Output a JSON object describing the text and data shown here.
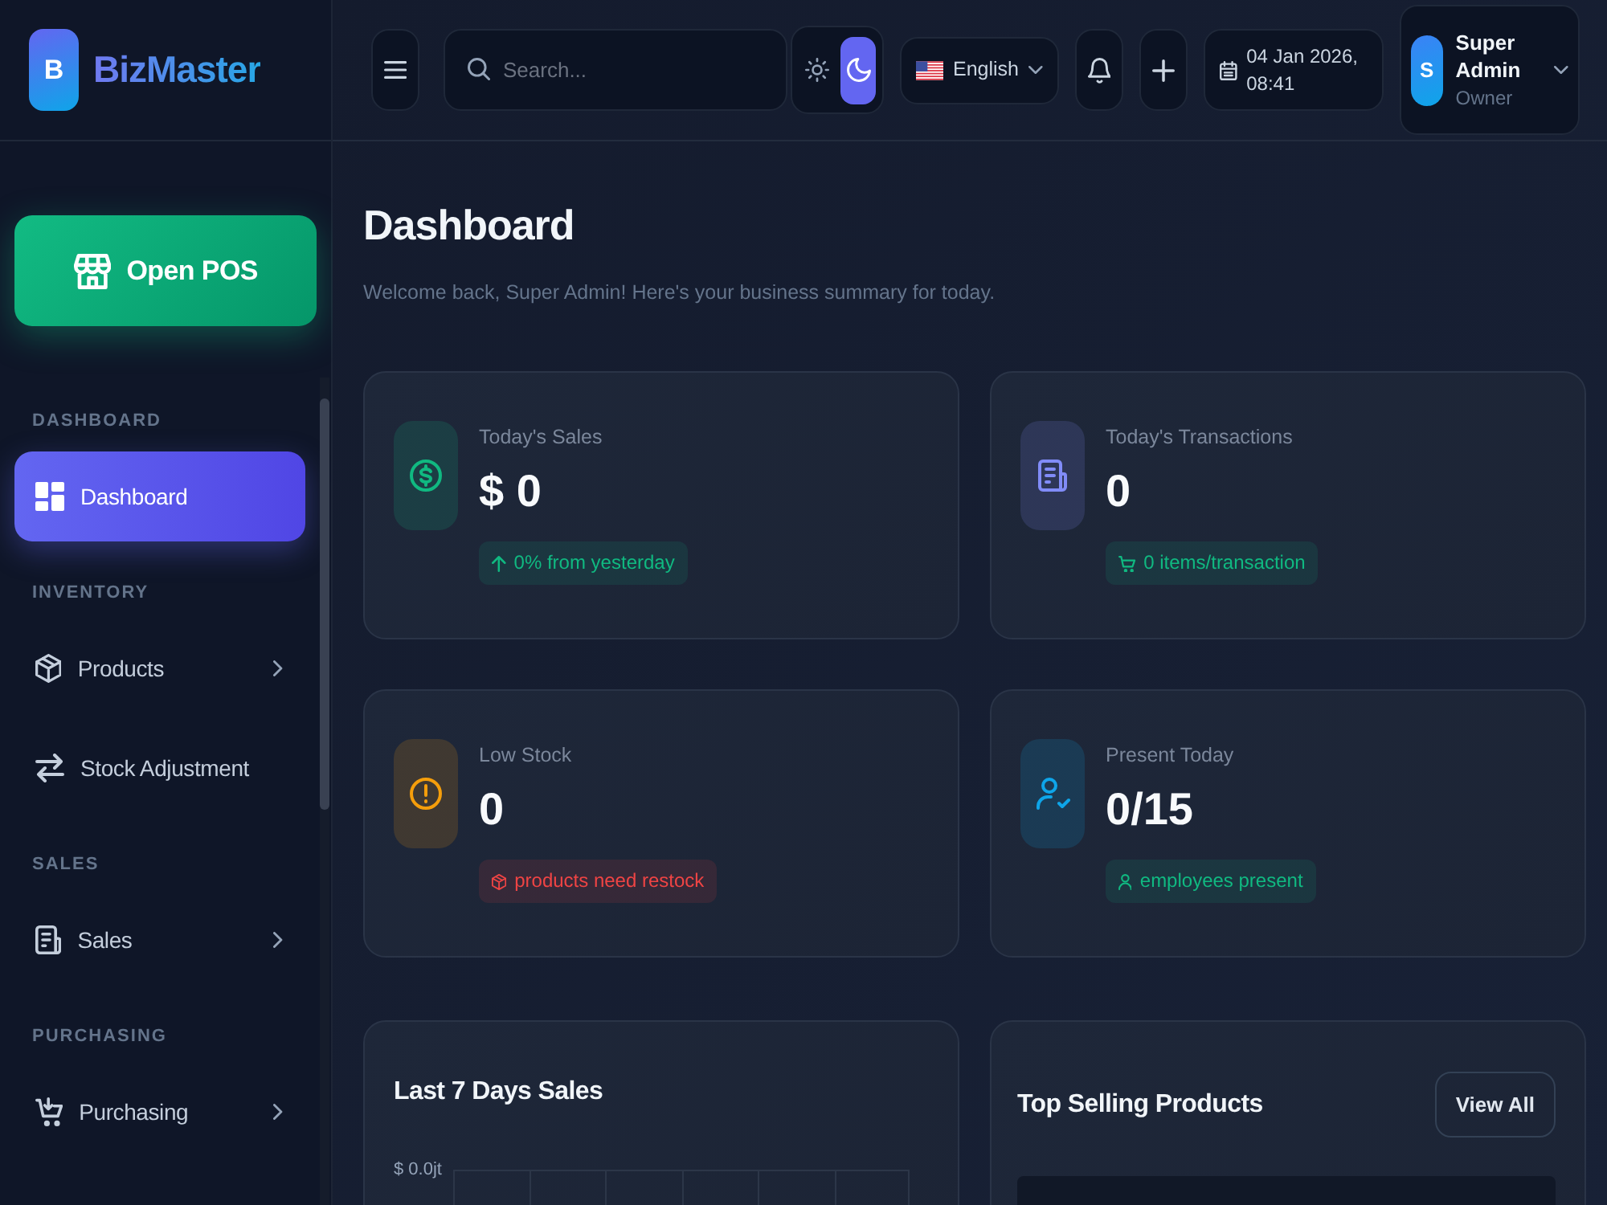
{
  "sidebar": {
    "brand": {
      "initial": "B",
      "name": "BizMaster"
    },
    "pos_button": {
      "label": "Open POS"
    },
    "sections": [
      {
        "title": "DASHBOARD",
        "items": [
          {
            "label": "Dashboard",
            "kind": "link",
            "selected": true
          }
        ]
      },
      {
        "title": "INVENTORY",
        "items": [
          {
            "label": "Products",
            "kind": "group",
            "selected": false
          },
          {
            "label": "Stock Adjustment",
            "kind": "link",
            "selected": false
          }
        ]
      },
      {
        "title": "SALES",
        "items": [
          {
            "label": "Sales",
            "kind": "group",
            "selected": false
          }
        ]
      },
      {
        "title": "PURCHASING",
        "items": [
          {
            "label": "Purchasing",
            "kind": "group",
            "selected": false
          }
        ]
      }
    ]
  },
  "topbar": {
    "search": {
      "placeholder": "Search..."
    },
    "theme_toggle": [
      {
        "selected": false
      },
      {
        "selected": true
      }
    ],
    "language": {
      "label": "English"
    },
    "date": "04 Jan 2026, 08:41",
    "user": {
      "initial": "S",
      "name": "Super Admin",
      "role": "Owner"
    }
  },
  "page": {
    "title": "Dashboard",
    "subtitle": "Welcome back, Super Admin! Here's your business summary for today."
  },
  "stats": [
    {
      "label": "Today's Sales",
      "value": "$ 0",
      "color": "#10b981",
      "badge": {
        "text": "0% from yesterday",
        "color": "#10b981"
      }
    },
    {
      "label": "Today's Transactions",
      "value": "0",
      "color": "#818cf8",
      "badge": {
        "text": "0 items/transaction",
        "color": "#10b981"
      }
    },
    {
      "label": "Low Stock",
      "value": "0",
      "color": "#f59e0b",
      "badge": {
        "text": "products need restock",
        "color": "#ef4444"
      }
    },
    {
      "label": "Present Today",
      "value": "0/15",
      "color": "#0ea5e9",
      "badge": {
        "text": "employees present",
        "color": "#10b981"
      }
    }
  ],
  "panels": [
    {
      "kind": "chart",
      "title": "Last 7 Days Sales",
      "y_axis_label": "$ 0.0jt"
    },
    {
      "kind": "table",
      "title": "Top Selling Products",
      "action": "View All"
    }
  ]
}
